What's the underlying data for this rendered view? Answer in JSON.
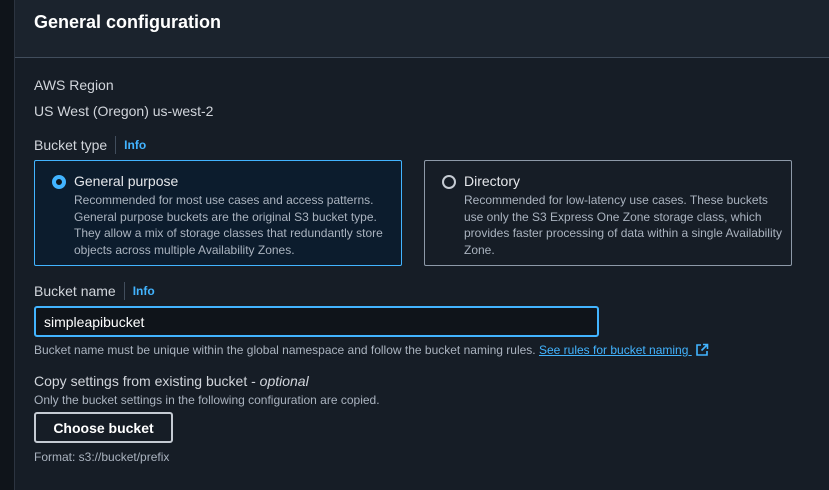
{
  "panel": {
    "title": "General configuration"
  },
  "region": {
    "label": "AWS Region",
    "value": "US West (Oregon) us-west-2"
  },
  "bucket_type": {
    "label": "Bucket type",
    "info": "Info",
    "options": [
      {
        "title": "General purpose",
        "selected": true,
        "description": "Recommended for most use cases and access patterns. General purpose buckets are the original S3 bucket type. They allow a mix of storage classes that redundantly store objects across multiple Availability Zones."
      },
      {
        "title": "Directory",
        "selected": false,
        "description": "Recommended for low-latency use cases. These buckets use only the S3 Express One Zone storage class, which provides faster processing of data within a single Availability Zone."
      }
    ]
  },
  "bucket_name": {
    "label": "Bucket name",
    "info": "Info",
    "value": "simpleapibucket",
    "hint": "Bucket name must be unique within the global namespace and follow the bucket naming rules.",
    "rules_link": "See rules for bucket naming"
  },
  "copy_settings": {
    "label": "Copy settings from existing bucket - ",
    "optional": "optional",
    "description": "Only the bucket settings in the following configuration are copied.",
    "button": "Choose bucket",
    "format": "Format: s3://bucket/prefix"
  },
  "colors": {
    "accent": "#42b4ff",
    "panel": "#161d26",
    "header": "#1b232d",
    "page": "#0f141a"
  },
  "icons": {
    "external_link": "external-link-icon"
  }
}
